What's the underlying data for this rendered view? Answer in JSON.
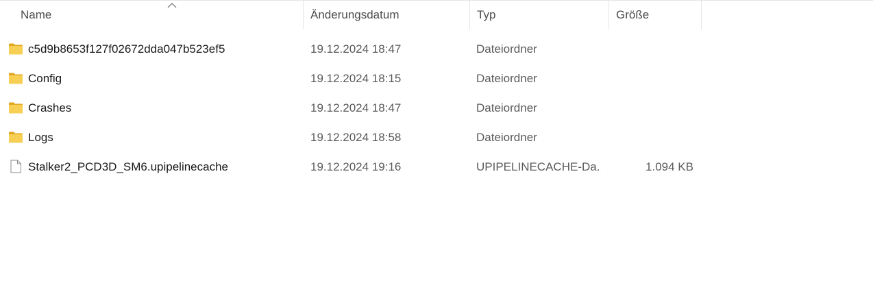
{
  "columns": {
    "name": "Name",
    "date": "Änderungsdatum",
    "type": "Typ",
    "size": "Größe"
  },
  "sort": {
    "column": "name",
    "direction": "ascending"
  },
  "files": [
    {
      "name": "c5d9b8653f127f02672dda047b523ef5",
      "date": "19.12.2024 18:47",
      "type": "Dateiordner",
      "size": "",
      "icon": "folder-icon"
    },
    {
      "name": "Config",
      "date": "19.12.2024 18:15",
      "type": "Dateiordner",
      "size": "",
      "icon": "folder-icon"
    },
    {
      "name": "Crashes",
      "date": "19.12.2024 18:47",
      "type": "Dateiordner",
      "size": "",
      "icon": "folder-icon"
    },
    {
      "name": "Logs",
      "date": "19.12.2024 18:58",
      "type": "Dateiordner",
      "size": "",
      "icon": "folder-icon"
    },
    {
      "name": "Stalker2_PCD3D_SM6.upipelinecache",
      "date": "19.12.2024 19:16",
      "type": "UPIPELINECACHE-Da...",
      "size": "1.094 KB",
      "icon": "file-icon"
    }
  ],
  "colors": {
    "folder": "#f5c542",
    "folder_dark": "#e0a820",
    "header_text": "#4c4c4c",
    "separator": "#e5e5e5"
  }
}
